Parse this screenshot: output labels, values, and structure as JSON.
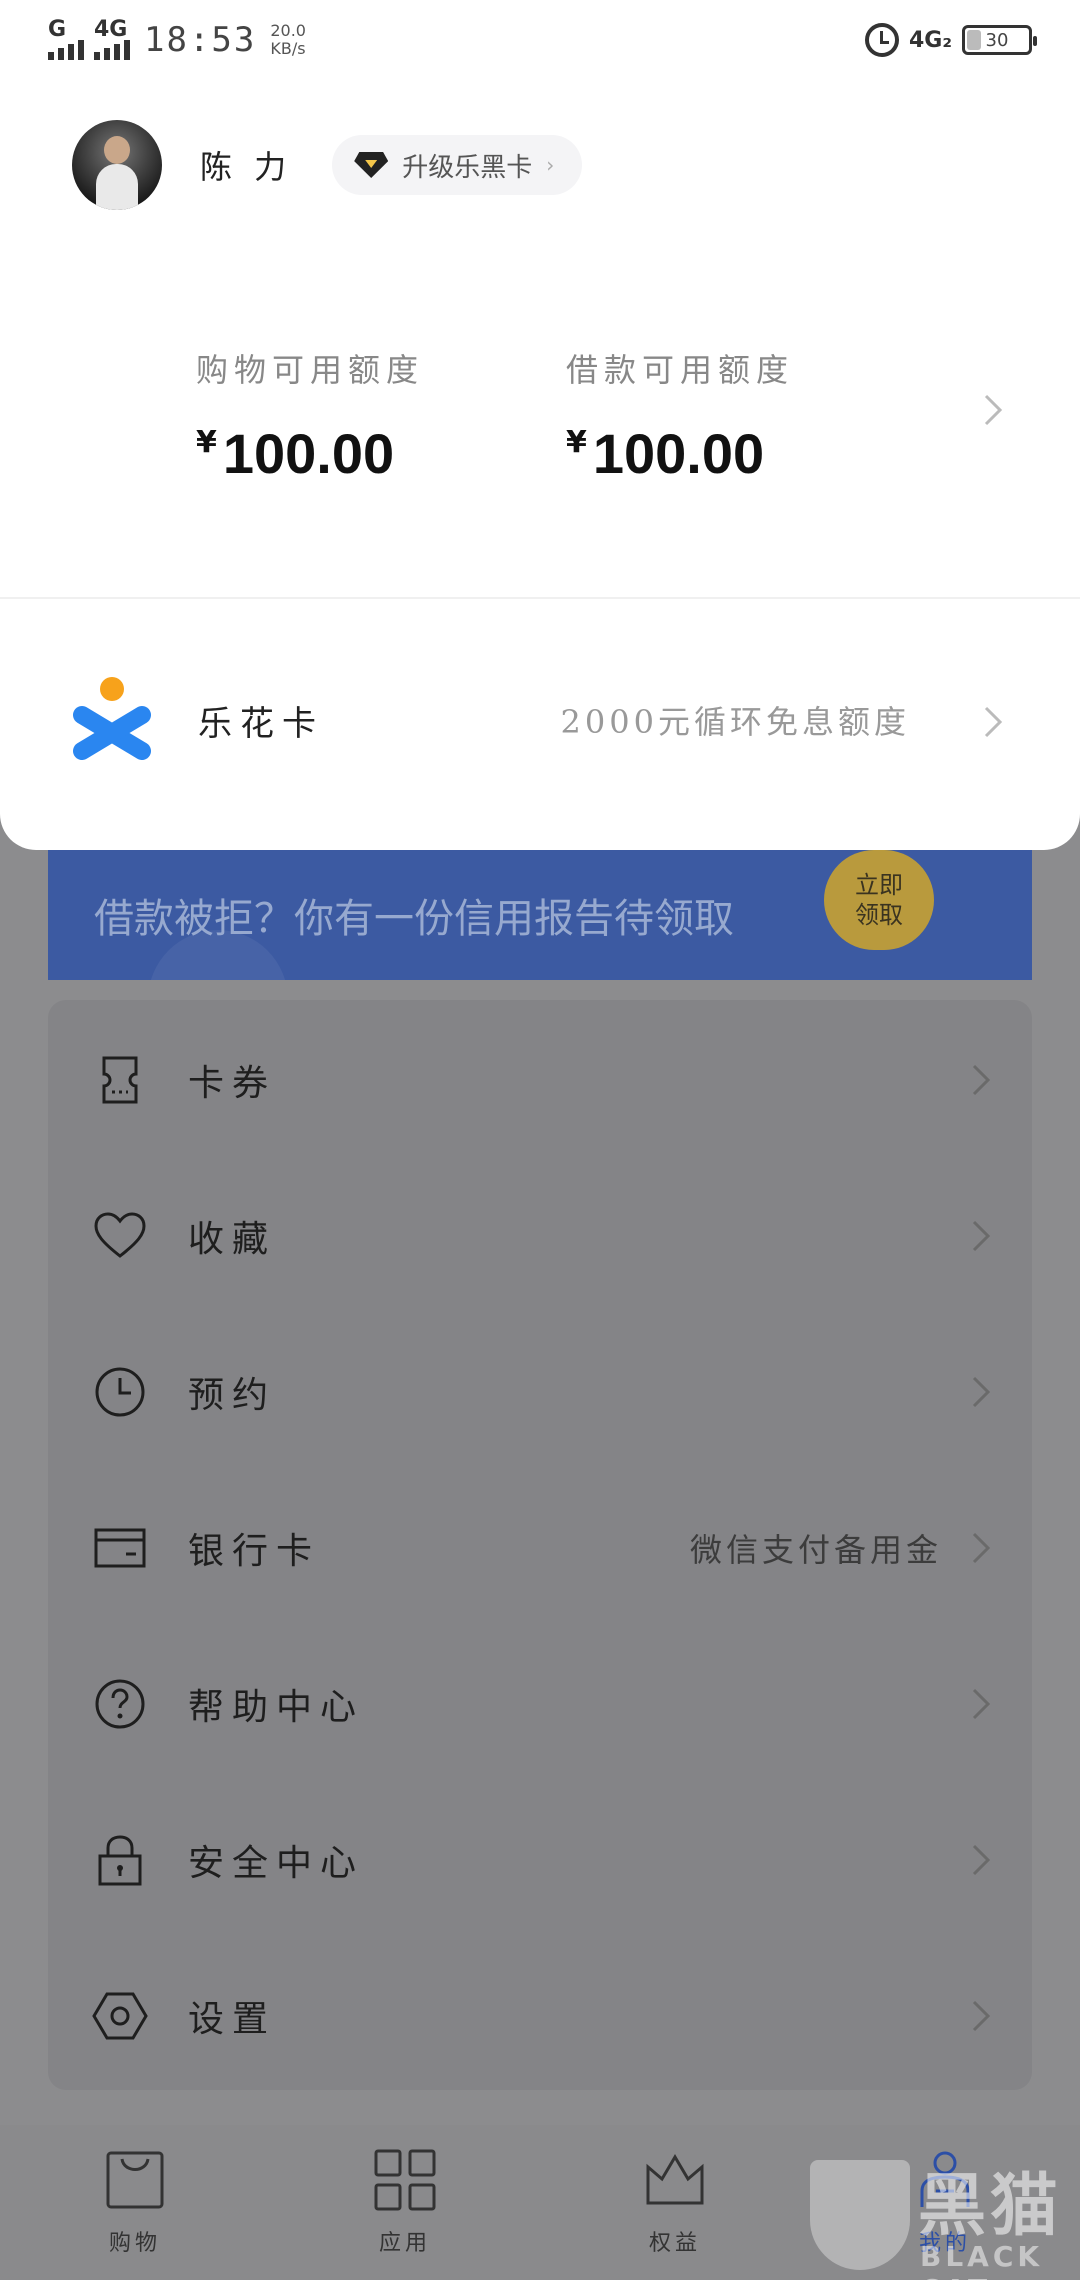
{
  "status_bar": {
    "signal1": "G",
    "signal2": "4G",
    "time": "18:53",
    "speed_value": "20.0",
    "speed_unit": "KB/s",
    "network": "4G₂",
    "battery": "30"
  },
  "profile": {
    "name": "陈 力",
    "upgrade_label": "升级乐黑卡",
    "upgrade_chevron": "›"
  },
  "credit": {
    "shopping_label": "购物可用额度",
    "shopping_currency": "¥",
    "shopping_amount": "100.00",
    "loan_label": "借款可用额度",
    "loan_currency": "¥",
    "loan_amount": "100.00"
  },
  "lehua": {
    "name": "乐花卡",
    "description": "2000元循环免息额度"
  },
  "banner": {
    "text": "借款被拒？你有一份信用报告待领取",
    "button_line1": "立即",
    "button_line2": "领取"
  },
  "menu": [
    {
      "label": "卡券",
      "icon": "ticket-icon",
      "sub": ""
    },
    {
      "label": "收藏",
      "icon": "heart-icon",
      "sub": ""
    },
    {
      "label": "预约",
      "icon": "clock-icon",
      "sub": ""
    },
    {
      "label": "银行卡",
      "icon": "bank-card-icon",
      "sub": "微信支付备用金"
    },
    {
      "label": "帮助中心",
      "icon": "help-icon",
      "sub": ""
    },
    {
      "label": "安全中心",
      "icon": "lock-icon",
      "sub": ""
    },
    {
      "label": "设置",
      "icon": "settings-icon",
      "sub": ""
    }
  ],
  "tabbar": [
    {
      "label": "购物",
      "icon": "shopping-bag-icon"
    },
    {
      "label": "应用",
      "icon": "apps-grid-icon"
    },
    {
      "label": "权益",
      "icon": "crown-icon"
    },
    {
      "label": "我的",
      "icon": "user-icon",
      "active": true
    }
  ],
  "watermark": {
    "text": "黑猫",
    "sub": "BLACK CAT"
  },
  "colors": {
    "brand_blue": "#2c4fa6",
    "lehua_orange": "#f7a21b",
    "lehua_blue": "#2a86f0"
  }
}
